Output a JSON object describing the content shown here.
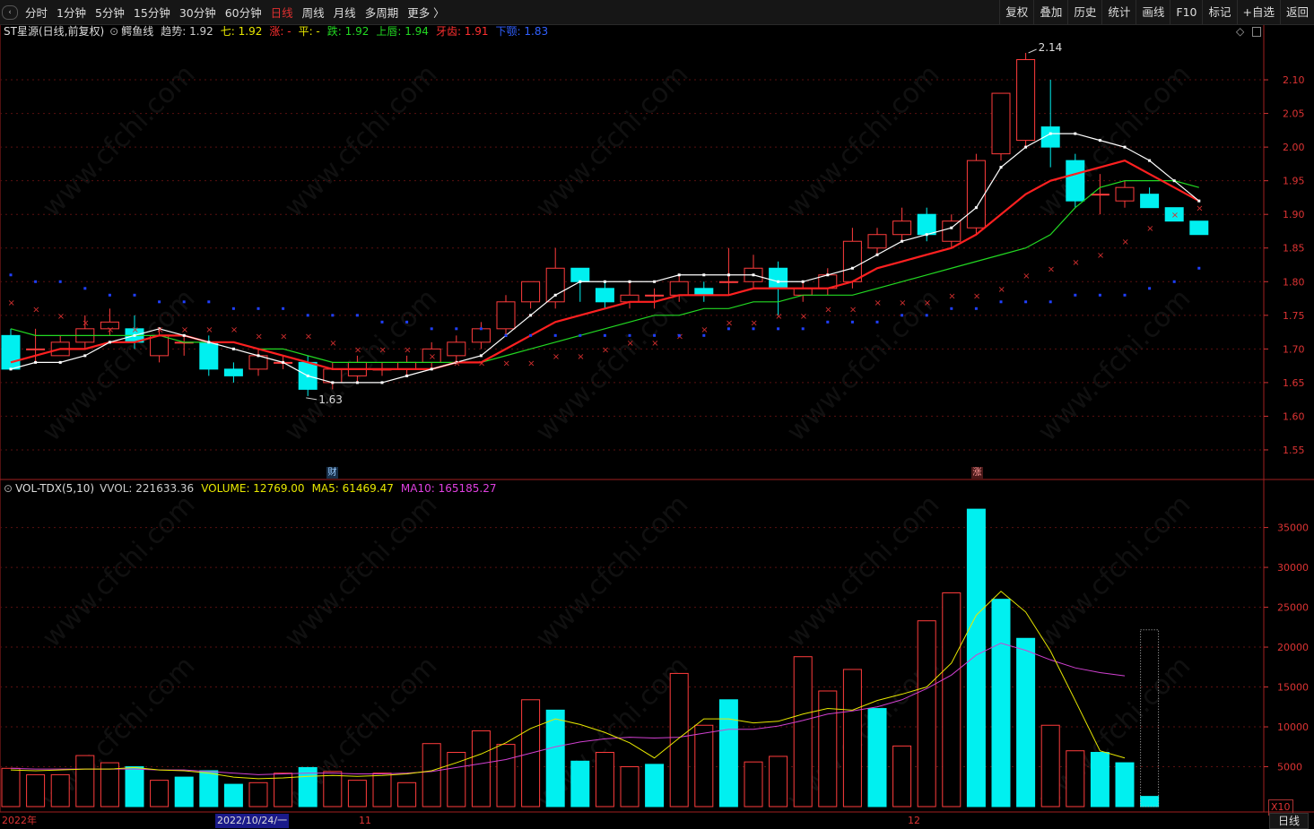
{
  "toolbar": {
    "periods": [
      {
        "label": "分时",
        "active": false
      },
      {
        "label": "1分钟",
        "active": false
      },
      {
        "label": "5分钟",
        "active": false
      },
      {
        "label": "15分钟",
        "active": false
      },
      {
        "label": "30分钟",
        "active": false
      },
      {
        "label": "60分钟",
        "active": false
      },
      {
        "label": "日线",
        "active": true
      },
      {
        "label": "周线",
        "active": false
      },
      {
        "label": "月线",
        "active": false
      },
      {
        "label": "多周期",
        "active": false
      },
      {
        "label": "更多 〉",
        "active": false
      }
    ],
    "right_tools": [
      "复权",
      "叠加",
      "历史",
      "统计",
      "画线",
      "F10",
      "标记",
      "+自选",
      "返回"
    ]
  },
  "main_info": {
    "title": "ST星源(日线,前复权)",
    "indicator": "鳄鱼线",
    "items": [
      {
        "text": "趋势: 1.92",
        "color": "#cccccc"
      },
      {
        "text": "七: 1.92",
        "color": "#e8e800"
      },
      {
        "text": "涨: -",
        "color": "#ff3030"
      },
      {
        "text": "平: -",
        "color": "#e8e800"
      },
      {
        "text": "跌: 1.92",
        "color": "#22d822"
      },
      {
        "text": "上唇: 1.94",
        "color": "#22d822"
      },
      {
        "text": "牙齿: 1.91",
        "color": "#ff3030"
      },
      {
        "text": "下颚: 1.83",
        "color": "#3060ff"
      }
    ]
  },
  "vol_info": {
    "indicator": "VOL-TDX(5,10)",
    "items": [
      {
        "text": "VVOL: 221633.36",
        "color": "#cccccc"
      },
      {
        "text": "VOLUME: 12769.00",
        "color": "#e8e800"
      },
      {
        "text": "MA5: 61469.47",
        "color": "#e8e800"
      },
      {
        "text": "MA10: 165185.27",
        "color": "#e040e0"
      }
    ]
  },
  "annotations": {
    "high_label": "2.14",
    "low_label": "1.63",
    "mark_finance": "财",
    "mark_limit": "涨"
  },
  "bottom_axis": {
    "labels": [
      "2022年",
      "2022/10/24/一",
      "11",
      "12"
    ],
    "multiplier": "X10",
    "period_button": "日线"
  },
  "watermark": "www.cfchi.com",
  "colors": {
    "up": "#ff3c3c",
    "down": "#00f0f0",
    "ma_fast": "#ffffff",
    "ma_mid": "#ff2020",
    "ma_slow": "#22d822",
    "cross": "#d83030",
    "dot": "#2040ff",
    "vol_ma5": "#e8e800",
    "vol_ma10": "#d040d0",
    "axis": "#d33333"
  },
  "chart_data": [
    {
      "type": "candlestick",
      "title": "ST星源(日线,前复权)",
      "ylim": [
        1.51,
        2.16
      ],
      "y_ticks": [
        1.55,
        1.6,
        1.65,
        1.7,
        1.75,
        1.8,
        1.85,
        1.9,
        1.95,
        2.0,
        2.05,
        2.1
      ],
      "candles": [
        [
          1.72,
          1.67,
          1.73,
          1.67
        ],
        [
          1.7,
          1.7,
          1.73,
          1.68
        ],
        [
          1.69,
          1.71,
          1.72,
          1.69
        ],
        [
          1.71,
          1.73,
          1.75,
          1.7
        ],
        [
          1.73,
          1.74,
          1.76,
          1.72
        ],
        [
          1.73,
          1.71,
          1.75,
          1.7
        ],
        [
          1.69,
          1.72,
          1.73,
          1.68
        ],
        [
          1.71,
          1.71,
          1.72,
          1.69
        ],
        [
          1.71,
          1.67,
          1.72,
          1.66
        ],
        [
          1.67,
          1.66,
          1.68,
          1.65
        ],
        [
          1.67,
          1.69,
          1.7,
          1.66
        ],
        [
          1.68,
          1.68,
          1.69,
          1.67
        ],
        [
          1.68,
          1.64,
          1.69,
          1.63
        ],
        [
          1.65,
          1.67,
          1.68,
          1.64
        ],
        [
          1.66,
          1.68,
          1.69,
          1.65
        ],
        [
          1.67,
          1.67,
          1.68,
          1.66
        ],
        [
          1.67,
          1.68,
          1.69,
          1.66
        ],
        [
          1.68,
          1.7,
          1.71,
          1.67
        ],
        [
          1.69,
          1.71,
          1.72,
          1.68
        ],
        [
          1.71,
          1.73,
          1.74,
          1.7
        ],
        [
          1.73,
          1.77,
          1.78,
          1.72
        ],
        [
          1.77,
          1.8,
          1.8,
          1.76
        ],
        [
          1.77,
          1.82,
          1.85,
          1.76
        ],
        [
          1.82,
          1.8,
          1.82,
          1.77
        ],
        [
          1.79,
          1.77,
          1.8,
          1.76
        ],
        [
          1.77,
          1.78,
          1.8,
          1.76
        ],
        [
          1.78,
          1.78,
          1.79,
          1.76
        ],
        [
          1.78,
          1.8,
          1.81,
          1.77
        ],
        [
          1.79,
          1.78,
          1.8,
          1.77
        ],
        [
          1.8,
          1.8,
          1.85,
          1.78
        ],
        [
          1.8,
          1.82,
          1.84,
          1.79
        ],
        [
          1.82,
          1.79,
          1.83,
          1.75
        ],
        [
          1.78,
          1.79,
          1.8,
          1.77
        ],
        [
          1.79,
          1.81,
          1.82,
          1.78
        ],
        [
          1.8,
          1.86,
          1.88,
          1.79
        ],
        [
          1.85,
          1.87,
          1.88,
          1.84
        ],
        [
          1.87,
          1.89,
          1.91,
          1.86
        ],
        [
          1.9,
          1.87,
          1.91,
          1.86
        ],
        [
          1.86,
          1.89,
          1.9,
          1.85
        ],
        [
          1.88,
          1.98,
          1.99,
          1.87
        ],
        [
          1.99,
          2.08,
          2.08,
          1.98
        ],
        [
          2.01,
          2.13,
          2.14,
          2.0
        ],
        [
          2.03,
          2.0,
          2.1,
          1.97
        ],
        [
          1.98,
          1.92,
          1.99,
          1.91
        ],
        [
          1.93,
          1.93,
          1.96,
          1.9
        ],
        [
          1.92,
          1.94,
          1.95,
          1.91
        ],
        [
          1.93,
          1.91,
          1.94,
          1.91
        ],
        [
          1.91,
          1.89,
          1.91,
          1.89
        ],
        [
          1.89,
          1.87,
          1.89,
          1.87
        ]
      ],
      "ma_fast": [
        1.67,
        1.68,
        1.68,
        1.69,
        1.71,
        1.72,
        1.73,
        1.72,
        1.71,
        1.7,
        1.69,
        1.68,
        1.66,
        1.65,
        1.65,
        1.65,
        1.66,
        1.67,
        1.68,
        1.69,
        1.72,
        1.75,
        1.78,
        1.8,
        1.8,
        1.8,
        1.8,
        1.81,
        1.81,
        1.81,
        1.81,
        1.8,
        1.8,
        1.81,
        1.82,
        1.84,
        1.86,
        1.87,
        1.88,
        1.91,
        1.97,
        2.0,
        2.02,
        2.02,
        2.01,
        2.0,
        1.98,
        1.95,
        1.92
      ],
      "ma_mid": [
        1.68,
        1.69,
        1.7,
        1.7,
        1.71,
        1.71,
        1.72,
        1.72,
        1.71,
        1.71,
        1.7,
        1.69,
        1.68,
        1.67,
        1.67,
        1.67,
        1.67,
        1.67,
        1.68,
        1.68,
        1.7,
        1.72,
        1.74,
        1.75,
        1.76,
        1.77,
        1.77,
        1.78,
        1.78,
        1.78,
        1.79,
        1.79,
        1.79,
        1.79,
        1.8,
        1.82,
        1.83,
        1.84,
        1.85,
        1.87,
        1.9,
        1.93,
        1.95,
        1.96,
        1.97,
        1.98,
        1.96,
        1.94,
        1.92
      ],
      "ma_slow": [
        1.73,
        1.72,
        1.72,
        1.72,
        1.72,
        1.72,
        1.72,
        1.71,
        1.71,
        1.71,
        1.7,
        1.7,
        1.69,
        1.68,
        1.68,
        1.68,
        1.68,
        1.68,
        1.68,
        1.68,
        1.69,
        1.7,
        1.71,
        1.72,
        1.73,
        1.74,
        1.75,
        1.75,
        1.76,
        1.76,
        1.77,
        1.77,
        1.78,
        1.78,
        1.78,
        1.79,
        1.8,
        1.81,
        1.82,
        1.83,
        1.84,
        1.85,
        1.87,
        1.91,
        1.94,
        1.95,
        1.95,
        1.95,
        1.94
      ],
      "cross_marks": [
        1.77,
        1.76,
        1.75,
        1.74,
        1.73,
        1.73,
        1.73,
        1.73,
        1.73,
        1.73,
        1.72,
        1.72,
        1.72,
        1.71,
        1.7,
        1.7,
        1.7,
        1.69,
        1.68,
        1.68,
        1.68,
        1.68,
        1.69,
        1.69,
        1.7,
        1.71,
        1.71,
        1.72,
        1.73,
        1.74,
        1.74,
        1.75,
        1.75,
        1.76,
        1.76,
        1.77,
        1.77,
        1.77,
        1.78,
        1.78,
        1.79,
        1.81,
        1.82,
        1.83,
        1.84,
        1.86,
        1.88,
        1.9,
        1.91
      ],
      "dot_marks": [
        1.81,
        1.8,
        1.8,
        1.79,
        1.78,
        1.78,
        1.77,
        1.77,
        1.77,
        1.76,
        1.76,
        1.76,
        1.75,
        1.75,
        1.75,
        1.74,
        1.74,
        1.73,
        1.73,
        1.73,
        1.72,
        1.72,
        1.72,
        1.72,
        1.72,
        1.72,
        1.72,
        1.72,
        1.72,
        1.73,
        1.73,
        1.73,
        1.73,
        1.74,
        1.74,
        1.74,
        1.75,
        1.75,
        1.76,
        1.76,
        1.77,
        1.77,
        1.77,
        1.78,
        1.78,
        1.78,
        1.79,
        1.8,
        1.82
      ],
      "high_annotation": {
        "index": 41,
        "value": 2.14
      },
      "low_annotation": {
        "index": 12,
        "value": 1.63
      }
    },
    {
      "type": "bar",
      "title": "VOL-TDX(5,10)",
      "ylim": [
        0,
        39000
      ],
      "y_ticks": [
        5000,
        10000,
        15000,
        20000,
        25000,
        30000,
        35000
      ],
      "volumes": [
        4800,
        4000,
        4000,
        6400,
        5500,
        5000,
        3300,
        3700,
        4500,
        2800,
        3000,
        4200,
        4900,
        4400,
        3300,
        4200,
        3000,
        7900,
        6800,
        9500,
        7800,
        13400,
        12100,
        5700,
        6800,
        5000,
        5300,
        16700,
        10200,
        13400,
        5600,
        6300,
        18800,
        14500,
        17200,
        12300,
        7600,
        23300,
        26800,
        37300,
        26000,
        21100,
        10200,
        7000,
        6800,
        5500,
        1277
      ],
      "up_flags": [
        true,
        true,
        true,
        true,
        true,
        false,
        true,
        false,
        false,
        false,
        true,
        true,
        false,
        true,
        true,
        true,
        true,
        true,
        true,
        true,
        true,
        true,
        false,
        false,
        true,
        true,
        false,
        true,
        true,
        false,
        true,
        true,
        true,
        true,
        true,
        false,
        true,
        true,
        true,
        false,
        false,
        false,
        true,
        true,
        false,
        false,
        false
      ],
      "ma5": [
        4600,
        4500,
        4600,
        4700,
        4700,
        4900,
        4600,
        4500,
        4200,
        3700,
        3500,
        3600,
        3800,
        3900,
        3800,
        3900,
        4100,
        4500,
        5500,
        6600,
        8000,
        9800,
        11000,
        10300,
        9300,
        8000,
        6100,
        8600,
        11000,
        11000,
        10500,
        10700,
        11600,
        12300,
        12100,
        13300,
        14100,
        15000,
        18000,
        24000,
        27000,
        24400,
        19500,
        13300,
        7000,
        6100
      ],
      "ma10": [
        4800,
        4700,
        4700,
        4700,
        4700,
        4700,
        4600,
        4600,
        4400,
        4200,
        4000,
        4100,
        4200,
        4200,
        4100,
        4100,
        4200,
        4400,
        4900,
        5400,
        5900,
        6700,
        7500,
        8100,
        8500,
        8700,
        8600,
        8700,
        9200,
        9700,
        9700,
        10100,
        10800,
        11600,
        12000,
        12500,
        13400,
        14800,
        16500,
        19000,
        20500,
        19600,
        18400,
        17400,
        16800,
        16400
      ]
    }
  ]
}
